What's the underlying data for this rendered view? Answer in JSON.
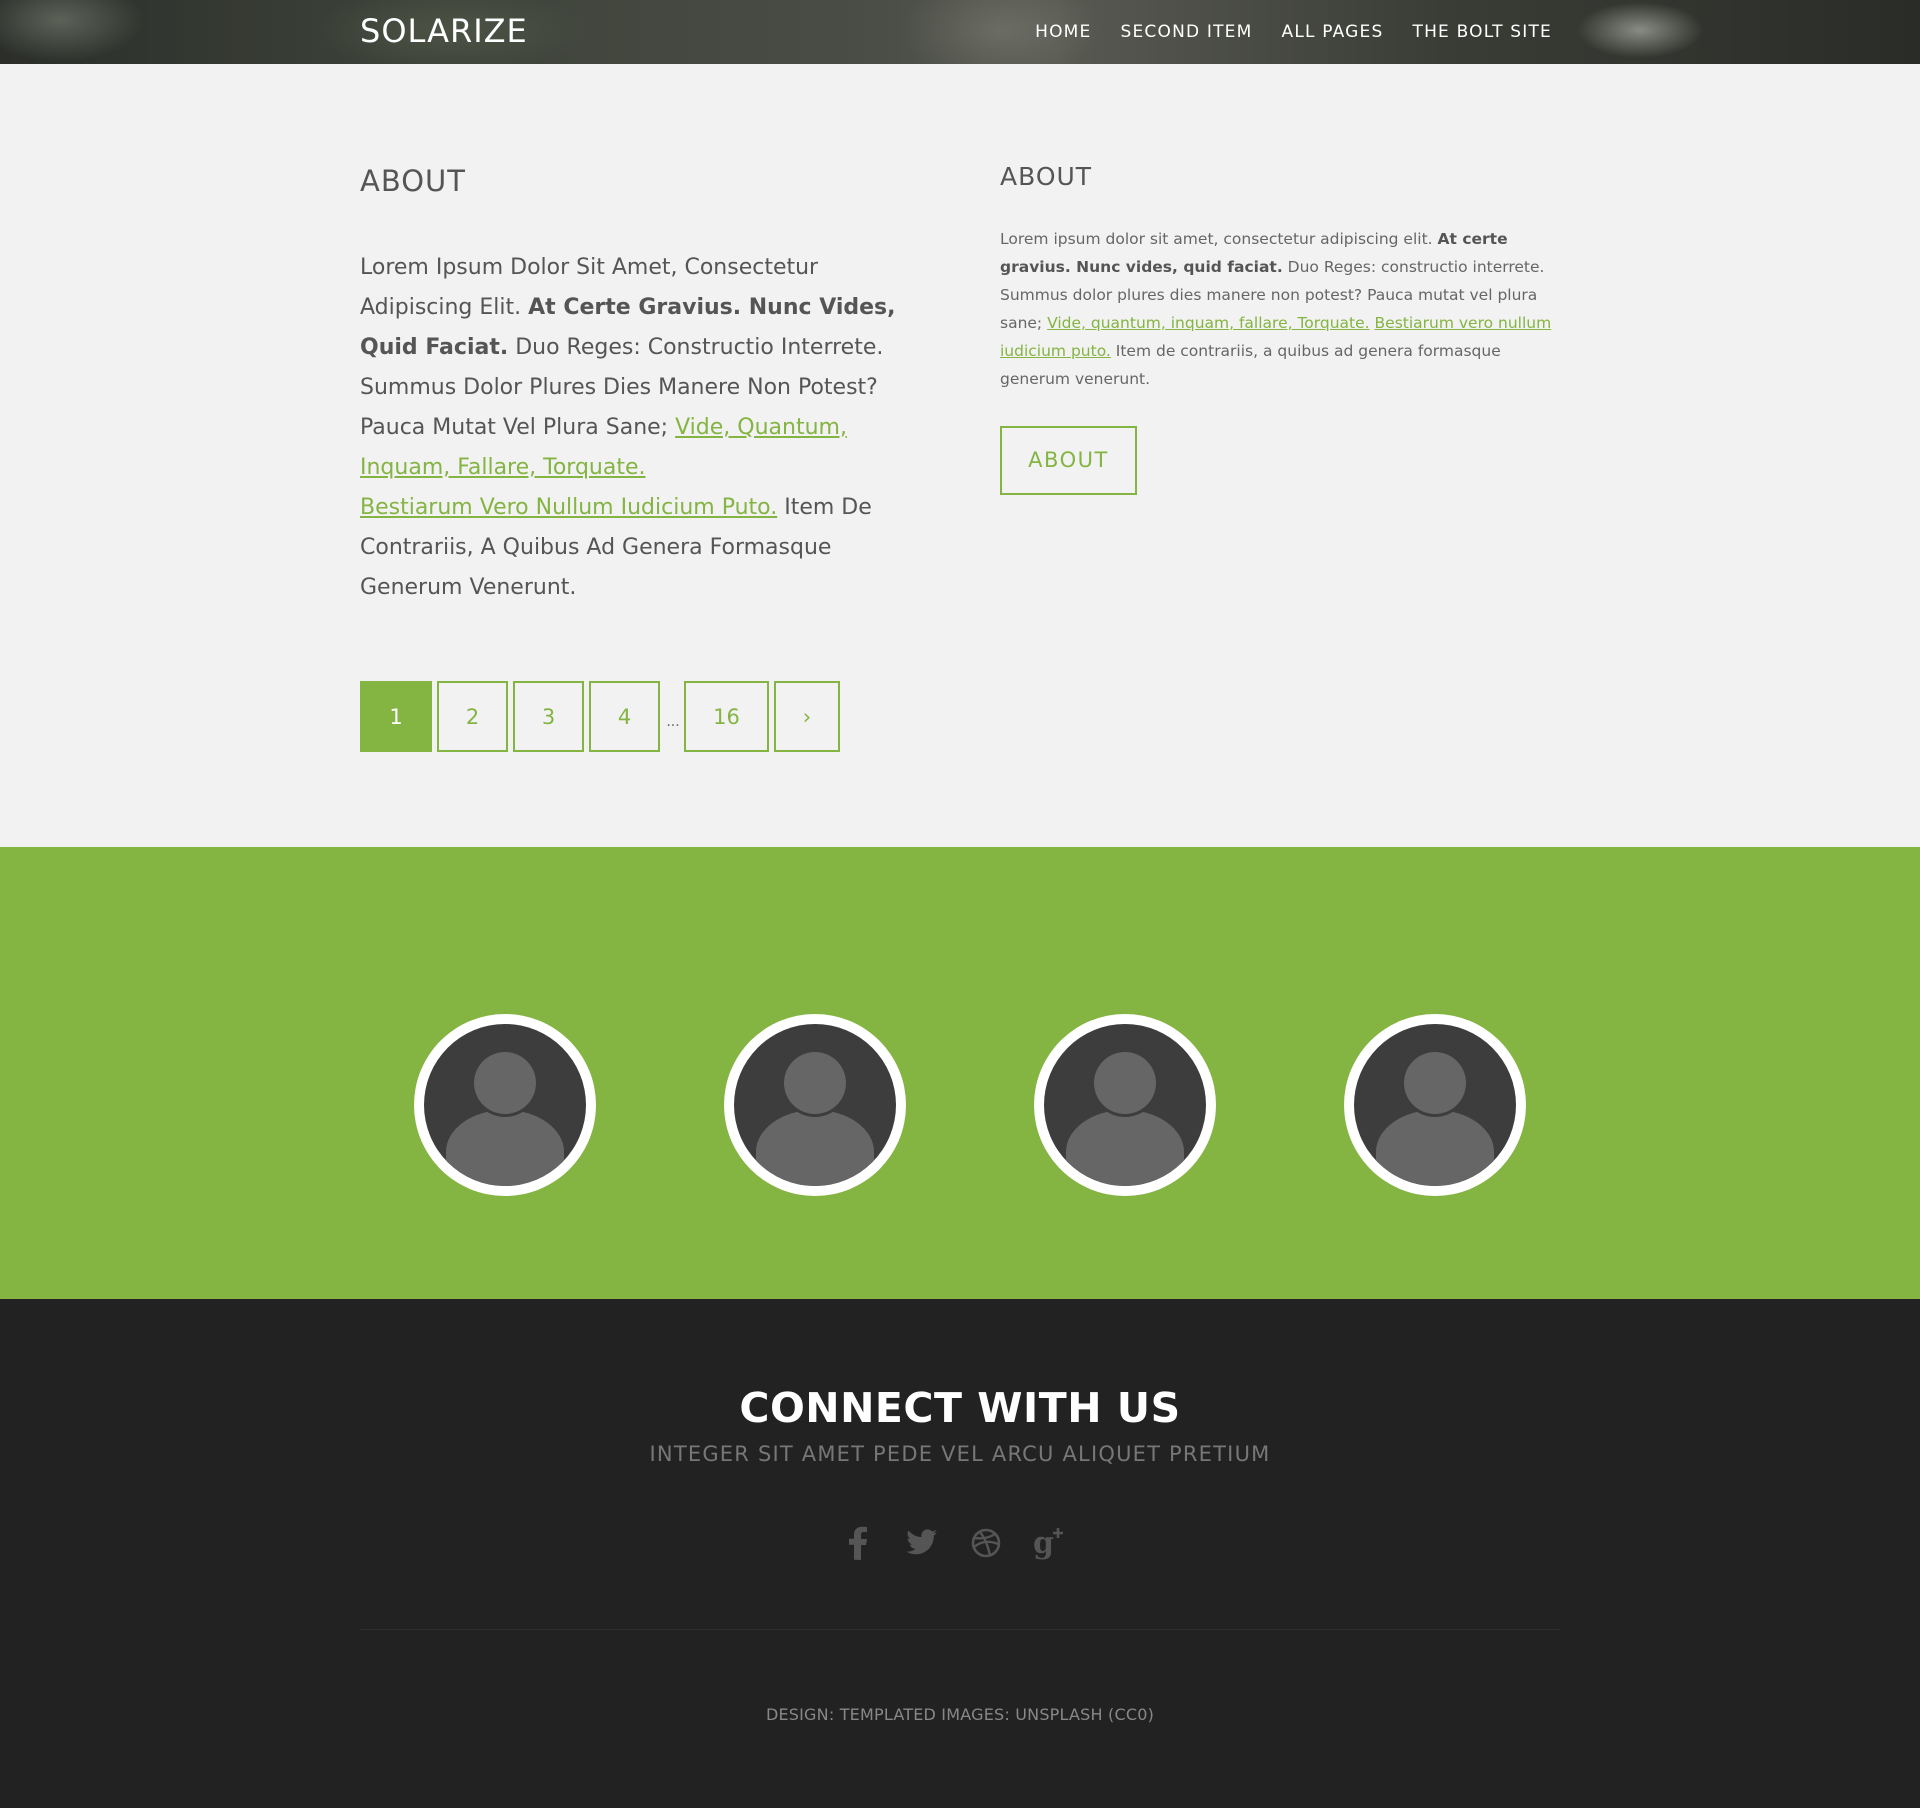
{
  "header": {
    "logo": "SOLARIZE",
    "nav": [
      "HOME",
      "SECOND ITEM",
      "ALL PAGES",
      "THE BOLT SITE"
    ]
  },
  "main": {
    "left": {
      "title": "ABOUT",
      "text1": "Lorem Ipsum Dolor Sit Amet, Consectetur Adipiscing Elit. ",
      "bold": "At Certe Gravius. Nunc Vides, Quid Faciat.",
      "text2": " Duo Reges: Constructio Interrete. Summus Dolor Plures Dies Manere Non Potest? Pauca Mutat Vel Plura Sane; ",
      "link1": "Vide, Quantum, Inquam, Fallare, Torquate.",
      "link2": "Bestiarum Vero Nullum Iudicium Puto.",
      "text3": " Item De Contrariis, A Quibus Ad Genera Formasque Generum Venerunt."
    },
    "right": {
      "title": "ABOUT",
      "text1": "Lorem ipsum dolor sit amet, consectetur adipiscing elit. ",
      "bold": "At certe gravius. Nunc vides, quid faciat.",
      "text2": " Duo Reges: constructio interrete. Summus dolor plures dies manere non potest? Pauca mutat vel plura sane; ",
      "link1": "Vide, quantum, inquam, fallare, Torquate.",
      "link2": "Bestiarum vero nullum iudicium puto.",
      "text3": " Item de contrariis, a quibus ad genera formasque generum venerunt.",
      "button": "ABOUT"
    },
    "pagination": {
      "pages": [
        "1",
        "2",
        "3",
        "4"
      ],
      "ellipsis": "...",
      "last": "16",
      "next": "›",
      "active": "1"
    }
  },
  "team": {
    "members": [
      "avatar-1",
      "avatar-2",
      "avatar-3",
      "avatar-4"
    ]
  },
  "footer": {
    "title": "CONNECT WITH US",
    "subtitle": "INTEGER SIT AMET PEDE VEL ARCU ALIQUET PRETIUM",
    "socials": [
      "facebook-icon",
      "twitter-icon",
      "dribbble-icon",
      "google-plus-icon"
    ],
    "credit": "DESIGN: TEMPLATED IMAGES: UNSPLASH (CC0)"
  },
  "colors": {
    "accent": "#84b441",
    "background": "#f2f2f2",
    "footer": "#222222",
    "avatar_dark": "#3d3d3d",
    "avatar_light": "#666666"
  }
}
